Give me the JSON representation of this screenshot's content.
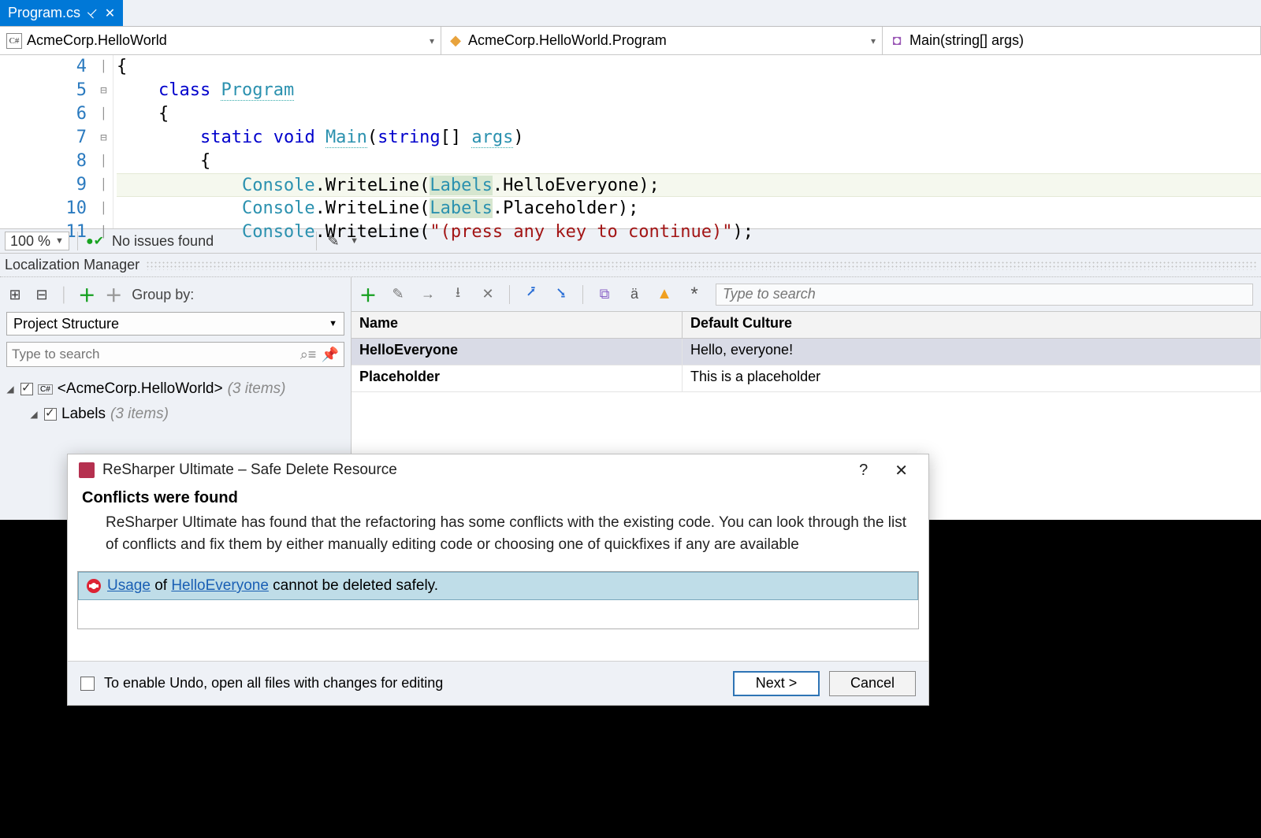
{
  "tab": {
    "title": "Program.cs"
  },
  "nav": {
    "namespace": "AcmeCorp.HelloWorld",
    "class": "AcmeCorp.HelloWorld.Program",
    "member": "Main(string[] args)"
  },
  "editor": {
    "lines": [
      {
        "n": 4
      },
      {
        "n": 5,
        "fold": true
      },
      {
        "n": 6
      },
      {
        "n": 7,
        "fold": true
      },
      {
        "n": 8
      },
      {
        "n": 9
      },
      {
        "n": 10
      },
      {
        "n": 11
      }
    ],
    "tokens": {
      "class_kw": "class",
      "Program": "Program",
      "static_kw": "static",
      "void_kw": "void",
      "Main": "Main",
      "string_kw": "string",
      "args": "args",
      "Console": "Console",
      "WriteLine": "WriteLine",
      "Labels": "Labels",
      "HelloEveryone": "HelloEveryone",
      "Placeholder": "Placeholder",
      "literal": "\"(press any key to continue)\""
    }
  },
  "status": {
    "zoom": "100 %",
    "issues": "No issues found"
  },
  "locman": {
    "title": "Localization Manager",
    "groupby_label": "Group by:",
    "view_combo": "Project Structure",
    "left_search_placeholder": "Type to search",
    "tree": {
      "project": "<AcmeCorp.HelloWorld>",
      "project_count": "(3 items)",
      "labels": "Labels",
      "labels_count": "(3 items)"
    },
    "right_search_placeholder": "Type to search",
    "grid": {
      "col_name": "Name",
      "col_value": "Default Culture",
      "rows": [
        {
          "name": "HelloEveryone",
          "value": "Hello, everyone!"
        },
        {
          "name": "Placeholder",
          "value": "This is a placeholder"
        }
      ]
    }
  },
  "dialog": {
    "title": "ReSharper Ultimate – Safe Delete Resource",
    "heading": "Conflicts were found",
    "body": "ReSharper Ultimate has found that the refactoring has some conflicts with the existing code. You can look through the list of conflicts and fix them by either manually editing code or choosing one of quickfixes if any are available",
    "conflict": {
      "usage": "Usage",
      "of": " of ",
      "ref": "HelloEveryone",
      "tail": " cannot be deleted safely."
    },
    "undo_label": "To enable Undo, open all files with changes for editing",
    "next": "Next >",
    "cancel": "Cancel"
  }
}
